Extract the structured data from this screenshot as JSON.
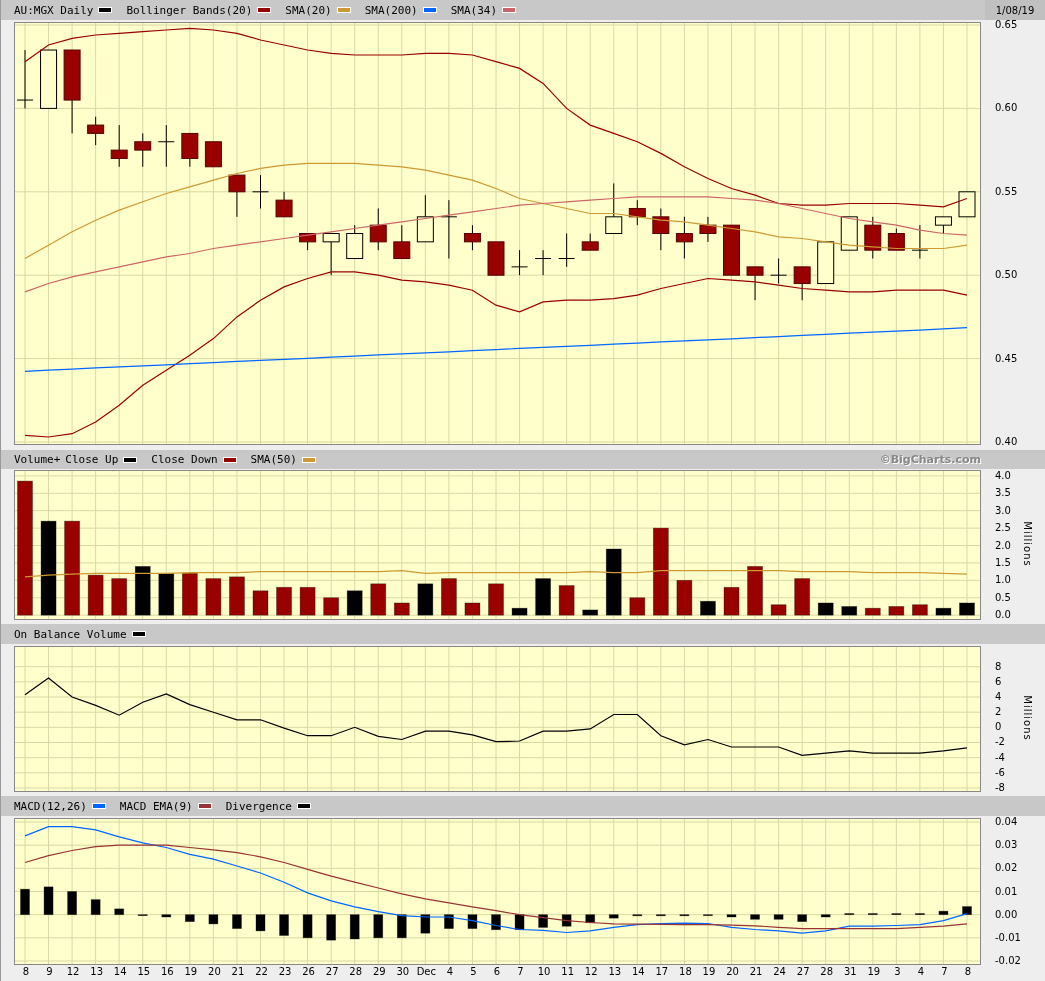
{
  "date": "1/08/19",
  "panels": [
    {
      "kind": "price",
      "chart_data": {
        "type": "candlestick",
        "grid": true,
        "ylim": [
          0.3988,
          0.6512
        ],
        "yticks": [
          {
            "value": 0.65,
            "label": "0.65"
          },
          {
            "value": 0.6,
            "label": "0.60"
          },
          {
            "value": 0.55,
            "label": "0.55"
          },
          {
            "value": 0.5,
            "label": "0.50"
          },
          {
            "value": 0.45,
            "label": "0.45"
          },
          {
            "value": 0.4,
            "label": "0.40"
          }
        ],
        "ohlc": [
          [
            0.605,
            0.635,
            0.6,
            0.605
          ],
          [
            0.6,
            0.635,
            0.6,
            0.635
          ],
          [
            0.635,
            0.635,
            0.585,
            0.605
          ],
          [
            0.59,
            0.595,
            0.578,
            0.585
          ],
          [
            0.575,
            0.59,
            0.565,
            0.57
          ],
          [
            0.58,
            0.585,
            0.565,
            0.575
          ],
          [
            0.58,
            0.59,
            0.565,
            0.58
          ],
          [
            0.585,
            0.585,
            0.565,
            0.57
          ],
          [
            0.58,
            0.58,
            0.565,
            0.565
          ],
          [
            0.56,
            0.56,
            0.535,
            0.55
          ],
          [
            0.55,
            0.56,
            0.54,
            0.55
          ],
          [
            0.545,
            0.55,
            0.535,
            0.535
          ],
          [
            0.525,
            0.525,
            0.515,
            0.52
          ],
          [
            0.52,
            0.525,
            0.5,
            0.525
          ],
          [
            0.51,
            0.53,
            0.51,
            0.525
          ],
          [
            0.53,
            0.54,
            0.515,
            0.52
          ],
          [
            0.52,
            0.53,
            0.51,
            0.51
          ],
          [
            0.52,
            0.548,
            0.52,
            0.535
          ],
          [
            0.535,
            0.545,
            0.51,
            0.535
          ],
          [
            0.525,
            0.53,
            0.515,
            0.52
          ],
          [
            0.52,
            0.52,
            0.5,
            0.5
          ],
          [
            0.505,
            0.515,
            0.5,
            0.505
          ],
          [
            0.51,
            0.515,
            0.5,
            0.51
          ],
          [
            0.51,
            0.525,
            0.505,
            0.51
          ],
          [
            0.52,
            0.525,
            0.515,
            0.515
          ],
          [
            0.525,
            0.555,
            0.525,
            0.535
          ],
          [
            0.54,
            0.545,
            0.53,
            0.535
          ],
          [
            0.535,
            0.54,
            0.515,
            0.525
          ],
          [
            0.525,
            0.535,
            0.51,
            0.52
          ],
          [
            0.53,
            0.535,
            0.52,
            0.525
          ],
          [
            0.53,
            0.53,
            0.5,
            0.5
          ],
          [
            0.505,
            0.505,
            0.485,
            0.5
          ],
          [
            0.5,
            0.51,
            0.495,
            0.5
          ],
          [
            0.505,
            0.505,
            0.485,
            0.495
          ],
          [
            0.495,
            0.52,
            0.495,
            0.52
          ],
          [
            0.515,
            0.535,
            0.515,
            0.535
          ],
          [
            0.53,
            0.535,
            0.51,
            0.515
          ],
          [
            0.525,
            0.528,
            0.515,
            0.515
          ],
          [
            0.515,
            0.53,
            0.51,
            0.515
          ],
          [
            0.53,
            0.535,
            0.525,
            0.535
          ],
          [
            0.535,
            0.55,
            0.535,
            0.55
          ]
        ],
        "series": [
          {
            "name": "AU:MGX Daily",
            "color": "#000000",
            "type": "candlestick"
          },
          {
            "name": "Bollinger Bands(20)",
            "color": "#990000",
            "type": "line",
            "values": [
              0.628,
              0.638,
              0.642,
              0.644,
              0.645,
              0.646,
              0.647,
              0.648,
              0.647,
              0.645,
              0.641,
              0.638,
              0.635,
              0.633,
              0.632,
              0.632,
              0.632,
              0.633,
              0.633,
              0.632,
              0.628,
              0.624,
              0.615,
              0.6,
              0.59,
              0.585,
              0.58,
              0.573,
              0.565,
              0.558,
              0.552,
              0.548,
              0.543,
              0.542,
              0.542,
              0.543,
              0.543,
              0.543,
              0.542,
              0.541,
              0.546
            ]
          },
          {
            "color": "#990000",
            "type": "line",
            "values": [
              0.404,
              0.403,
              0.405,
              0.412,
              0.422,
              0.434,
              0.443,
              0.452,
              0.462,
              0.475,
              0.485,
              0.493,
              0.498,
              0.502,
              0.502,
              0.5,
              0.497,
              0.496,
              0.494,
              0.491,
              0.482,
              0.478,
              0.484,
              0.485,
              0.485,
              0.486,
              0.488,
              0.492,
              0.495,
              0.498,
              0.497,
              0.496,
              0.494,
              0.492,
              0.491,
              0.49,
              0.49,
              0.491,
              0.491,
              0.491,
              0.488
            ]
          },
          {
            "name": "SMA(20)",
            "color": "#cc9933",
            "type": "line",
            "values": [
              0.51,
              0.518,
              0.526,
              0.533,
              0.539,
              0.544,
              0.549,
              0.553,
              0.557,
              0.561,
              0.564,
              0.566,
              0.567,
              0.567,
              0.567,
              0.566,
              0.565,
              0.563,
              0.56,
              0.557,
              0.552,
              0.546,
              0.543,
              0.54,
              0.537,
              0.537,
              0.535,
              0.533,
              0.532,
              0.53,
              0.528,
              0.526,
              0.523,
              0.522,
              0.52,
              0.518,
              0.517,
              0.516,
              0.516,
              0.516,
              0.518
            ]
          },
          {
            "name": "SMA(200)",
            "color": "#0066ff",
            "type": "line",
            "values": [
              0.4424,
              0.4431,
              0.4437,
              0.4444,
              0.445,
              0.4457,
              0.4463,
              0.447,
              0.4476,
              0.4483,
              0.4489,
              0.4496,
              0.4502,
              0.4509,
              0.4515,
              0.4522,
              0.4528,
              0.4535,
              0.4541,
              0.4548,
              0.4554,
              0.4561,
              0.4567,
              0.4574,
              0.458,
              0.4587,
              0.4593,
              0.46,
              0.4606,
              0.4613,
              0.4619,
              0.4626,
              0.4632,
              0.4639,
              0.4645,
              0.4652,
              0.4658,
              0.4665,
              0.4671,
              0.4678,
              0.4686
            ]
          },
          {
            "name": "SMA(34)",
            "color": "#cc6666",
            "type": "line",
            "values": [
              0.49,
              0.495,
              0.499,
              0.502,
              0.505,
              0.508,
              0.511,
              0.513,
              0.516,
              0.518,
              0.52,
              0.522,
              0.524,
              0.526,
              0.528,
              0.53,
              0.532,
              0.534,
              0.536,
              0.538,
              0.54,
              0.542,
              0.543,
              0.544,
              0.545,
              0.546,
              0.547,
              0.547,
              0.547,
              0.547,
              0.546,
              0.545,
              0.543,
              0.54,
              0.537,
              0.534,
              0.532,
              0.53,
              0.527,
              0.525,
              0.524
            ]
          }
        ]
      }
    },
    {
      "kind": "volume",
      "legend_prefix": "Volume+",
      "credit": "©BigCharts.com",
      "chart_data": {
        "type": "bar",
        "grid": true,
        "ylabel": "Millions",
        "ylim": [
          -0.11,
          4.14
        ],
        "yticks": [
          {
            "value": 4,
            "label": "4.0"
          },
          {
            "value": 3.5,
            "label": "3.5"
          },
          {
            "value": 3,
            "label": "3.0"
          },
          {
            "value": 2.5,
            "label": "2.5"
          },
          {
            "value": 2,
            "label": "2.0"
          },
          {
            "value": 1.5,
            "label": "1.5"
          },
          {
            "value": 1,
            "label": "1.0"
          },
          {
            "value": 0.5,
            "label": "0.5"
          },
          {
            "value": 0,
            "label": "0.0"
          }
        ],
        "series": [
          {
            "name": "Close Up",
            "color": "#000000",
            "values": [
              null,
              2.7,
              null,
              null,
              null,
              1.4,
              1.2,
              null,
              null,
              null,
              null,
              null,
              null,
              null,
              0.7,
              null,
              null,
              0.9,
              null,
              null,
              null,
              0.2,
              1.05,
              null,
              0.15,
              1.9,
              null,
              null,
              null,
              0.4,
              null,
              null,
              null,
              null,
              0.35,
              0.25,
              null,
              null,
              null,
              0.2,
              0.35
            ]
          },
          {
            "name": "Close Down",
            "color": "#990000",
            "values": [
              3.85,
              null,
              2.7,
              1.15,
              1.05,
              null,
              null,
              1.2,
              1.05,
              1.1,
              0.7,
              0.8,
              0.8,
              0.5,
              null,
              0.9,
              0.35,
              null,
              1.05,
              0.35,
              0.9,
              null,
              null,
              0.85,
              null,
              null,
              0.5,
              2.5,
              1.0,
              null,
              0.8,
              1.4,
              0.3,
              1.05,
              null,
              null,
              0.2,
              0.25,
              0.3,
              null,
              null
            ]
          },
          {
            "name": "SMA(50)",
            "color": "#cc9933",
            "type": "line",
            "values": [
              1.1,
              1.15,
              1.18,
              1.2,
              1.2,
              1.2,
              1.2,
              1.22,
              1.22,
              1.22,
              1.25,
              1.25,
              1.25,
              1.25,
              1.25,
              1.25,
              1.28,
              1.2,
              1.22,
              1.22,
              1.22,
              1.22,
              1.22,
              1.22,
              1.25,
              1.22,
              1.22,
              1.28,
              1.28,
              1.28,
              1.28,
              1.28,
              1.28,
              1.25,
              1.25,
              1.25,
              1.22,
              1.22,
              1.22,
              1.2,
              1.18
            ]
          }
        ]
      }
    },
    {
      "kind": "obv",
      "chart_data": {
        "type": "line",
        "grid": true,
        "ylabel": "Millions",
        "ylim": [
          -8.4,
          10.6
        ],
        "yticks": [
          {
            "value": 8,
            "label": "8"
          },
          {
            "value": 6,
            "label": "6"
          },
          {
            "value": 4,
            "label": "4"
          },
          {
            "value": 2,
            "label": "2"
          },
          {
            "value": 0,
            "label": "0"
          },
          {
            "value": -2,
            "label": "-2"
          },
          {
            "value": -4,
            "label": "-4"
          },
          {
            "value": -6,
            "label": "-6"
          },
          {
            "value": -8,
            "label": "-8"
          }
        ],
        "series": [
          {
            "name": "On Balance Volume",
            "color": "#000000",
            "values": [
              4.3,
              6.5,
              4,
              2.9,
              1.6,
              3.3,
              4.4,
              3,
              2,
              1,
              1,
              -0.1,
              -1.1,
              -1.1,
              0,
              -1.2,
              -1.6,
              -0.5,
              -0.5,
              -1,
              -1.9,
              -1.8,
              -0.5,
              -0.5,
              -0.2,
              1.7,
              1.7,
              -1.1,
              -2.3,
              -1.6,
              -2.6,
              -2.6,
              -2.6,
              -3.7,
              -3.4,
              -3.1,
              -3.4,
              -3.4,
              -3.4,
              -3.1,
              -2.7
            ]
          }
        ]
      }
    },
    {
      "kind": "macd",
      "chart_data": {
        "type": "line",
        "grid": true,
        "ylim": [
          -0.0213,
          0.0413
        ],
        "categories": [
          "8",
          "9",
          "12",
          "13",
          "14",
          "15",
          "16",
          "19",
          "20",
          "21",
          "22",
          "23",
          "26",
          "27",
          "28",
          "29",
          "30",
          "Dec",
          "4",
          "5",
          "6",
          "7",
          "10",
          "11",
          "12",
          "13",
          "14",
          "17",
          "18",
          "19",
          "20",
          "21",
          "24",
          "27",
          "28",
          "31",
          "19",
          "3",
          "4",
          "7",
          "8"
        ],
        "yticks": [
          {
            "value": 0.04,
            "label": "0.04"
          },
          {
            "value": 0.03,
            "label": "0.03"
          },
          {
            "value": 0.02,
            "label": "0.02"
          },
          {
            "value": 0.01,
            "label": "0.01"
          },
          {
            "value": 0,
            "label": "0.00"
          },
          {
            "value": -0.01,
            "label": "-0.01"
          },
          {
            "value": -0.02,
            "label": "-0.02"
          }
        ],
        "series": [
          {
            "name": "MACD(12,26)",
            "color": "#0066ff",
            "values": [
              0.034,
              0.038,
              0.038,
              0.0366,
              0.0336,
              0.031,
              0.029,
              0.026,
              0.024,
              0.021,
              0.018,
              0.014,
              0.0094,
              0.006,
              0.0034,
              0.0013,
              -0.0004,
              -0.001,
              -0.001,
              -0.0026,
              -0.0047,
              -0.0064,
              -0.0068,
              -0.0077,
              -0.007,
              -0.0055,
              -0.0043,
              -0.0038,
              -0.0037,
              -0.0038,
              -0.0055,
              -0.0064,
              -0.007,
              -0.008,
              -0.007,
              -0.005,
              -0.005,
              -0.0047,
              -0.0043,
              -0.0026,
              0.0004
            ]
          },
          {
            "name": "MACD EMA(9)",
            "color": "#993333",
            "values": [
              0.0225,
              0.0255,
              0.0277,
              0.0294,
              0.03,
              0.03,
              0.03,
              0.029,
              0.028,
              0.0268,
              0.025,
              0.0225,
              0.0196,
              0.0166,
              0.014,
              0.0115,
              0.009,
              0.0068,
              0.0051,
              0.0034,
              0.0017,
              0,
              -0.0013,
              -0.0026,
              -0.0034,
              -0.004,
              -0.0041,
              -0.0042,
              -0.0043,
              -0.0043,
              -0.0045,
              -0.0048,
              -0.0055,
              -0.006,
              -0.006,
              -0.006,
              -0.006,
              -0.006,
              -0.0055,
              -0.005,
              -0.004
            ]
          },
          {
            "name": "Divergence",
            "color": "#000000",
            "type": "bar",
            "values": [
              0.011,
              0.012,
              0.01,
              0.0065,
              0.0025,
              0,
              -0.001,
              -0.003,
              -0.004,
              -0.006,
              -0.007,
              -0.009,
              -0.01,
              -0.011,
              -0.0105,
              -0.01,
              -0.01,
              -0.008,
              -0.006,
              -0.006,
              -0.0065,
              -0.0065,
              -0.0055,
              -0.005,
              -0.0035,
              -0.0015,
              -0.0005,
              -0.0005,
              -0.0005,
              0,
              -0.001,
              -0.002,
              -0.002,
              -0.003,
              -0.001,
              0.0005,
              0.0005,
              0.0005,
              0.0005,
              0.0015,
              0.0035
            ]
          }
        ]
      }
    }
  ]
}
